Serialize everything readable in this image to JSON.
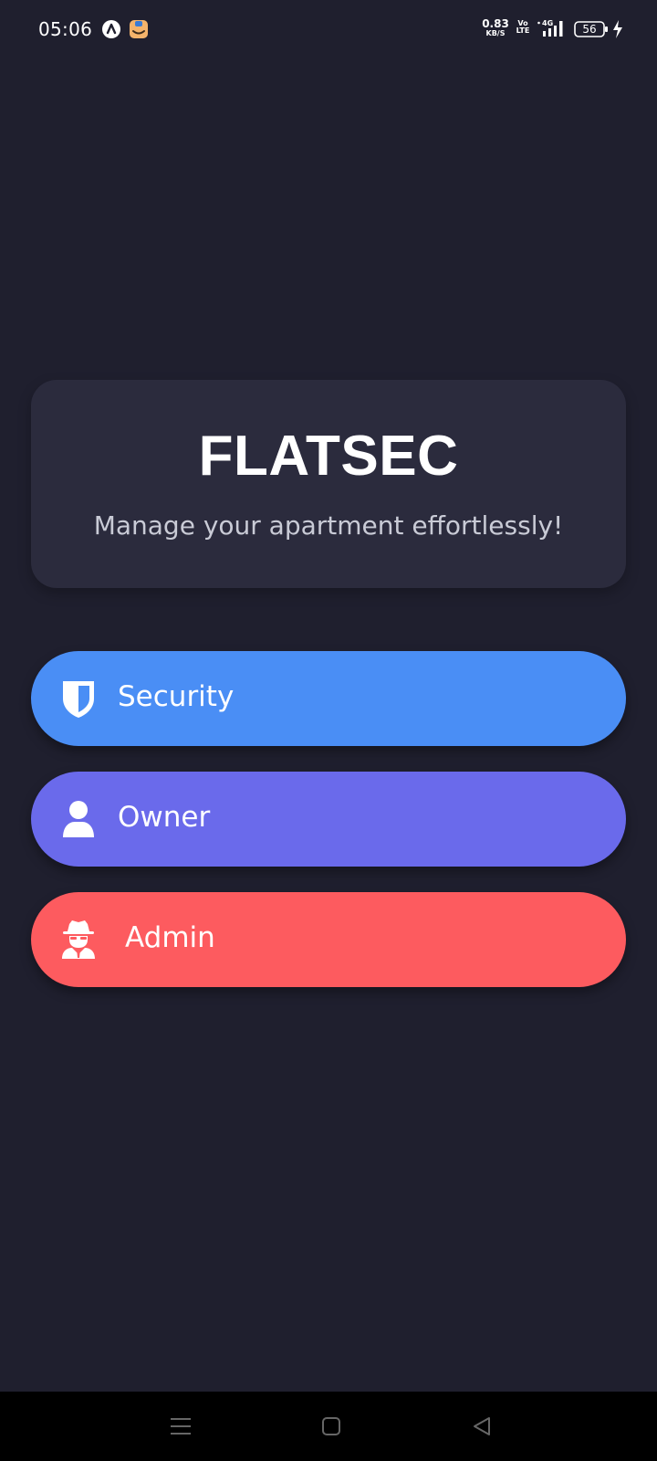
{
  "status_bar": {
    "time": "05:06",
    "network_speed_value": "0.83",
    "network_speed_unit": "KB/S",
    "volte_top": "Vo",
    "volte_bottom": "LTE",
    "signal_type": "4G",
    "battery_level": "56",
    "notification_icons": [
      "app-a-icon",
      "app-notification-icon"
    ],
    "charging": true
  },
  "header": {
    "title": "FLATSEC",
    "tagline": "Manage your apartment effortlessly!"
  },
  "roles": [
    {
      "label": "Security",
      "icon": "shield-icon",
      "color": "#4a8ef5"
    },
    {
      "label": "Owner",
      "icon": "user-icon",
      "color": "#6a6aeb"
    },
    {
      "label": "Admin",
      "icon": "spy-icon",
      "color": "#fd5b5f"
    }
  ],
  "nav_bar": {
    "buttons": [
      "menu-icon",
      "home-icon",
      "back-icon"
    ]
  },
  "colors": {
    "background": "#1f1f2e",
    "card": "#2b2b3d",
    "nav_bar": "#000000"
  }
}
